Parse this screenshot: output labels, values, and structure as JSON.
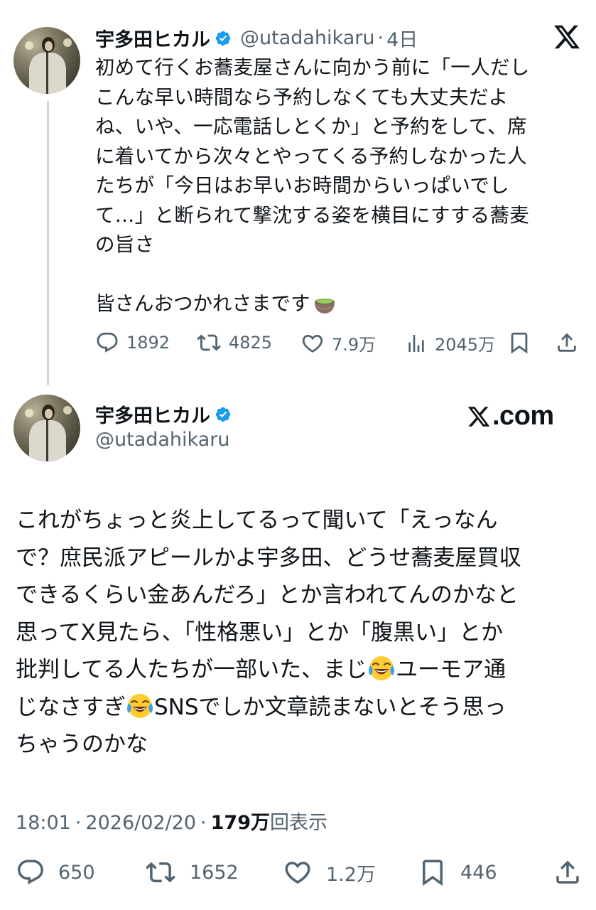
{
  "tweet1": {
    "display_name": "宇多田ヒカル",
    "handle": "@utadahikaru",
    "separator": "·",
    "time_ago": "4日",
    "text": "初めて行くお蕎麦屋さんに向かう前に「一人だし\nこんな早い時間なら予約しなくても大丈夫だよ\nね、いや、一応電話しとくか」と予約をして、席\nに着いてから次々とやってくる予約しなかった人\nたちが「今日はお早いお時間からいっぱいでし\nて…」と断られて撃沈する姿を横目にすする蕎麦\nの旨さ",
    "text2": "皆さんおつかれさまです",
    "emoji": "tea-icon",
    "replies": "1892",
    "reposts": "4825",
    "likes": "7.9万",
    "views": "2045万"
  },
  "tweet2": {
    "display_name": "宇多田ヒカル",
    "handle": "@utadahikaru",
    "brand": "X.com",
    "text_parts": {
      "p1": "これがちょっと炎上してるって聞いて「えっなん\nで？庶民派アピールかよ宇多田、どうせ蕎麦屋買収\nできるくらい金あんだろ」とか言われてんのかなと\n思ってX見たら、「性格悪い」とか「腹黒い」とか\n批判してる人たちが一部いた、まじ",
      "p2": "ユーモア通\nじなさすぎ",
      "p3": "SNSでしか文章読まないとそう思っ\nちゃうのかな"
    },
    "time": "18:01",
    "separator": "·",
    "date": "2026/02/20",
    "views_count": "179万",
    "views_label": "回表示",
    "replies": "650",
    "reposts": "1652",
    "likes": "1.2万",
    "bookmarks": "446"
  },
  "colors": {
    "text": "#0f1419",
    "secondary": "#536471",
    "verified": "#1d9bf0",
    "thread_line": "#cfd9de"
  }
}
